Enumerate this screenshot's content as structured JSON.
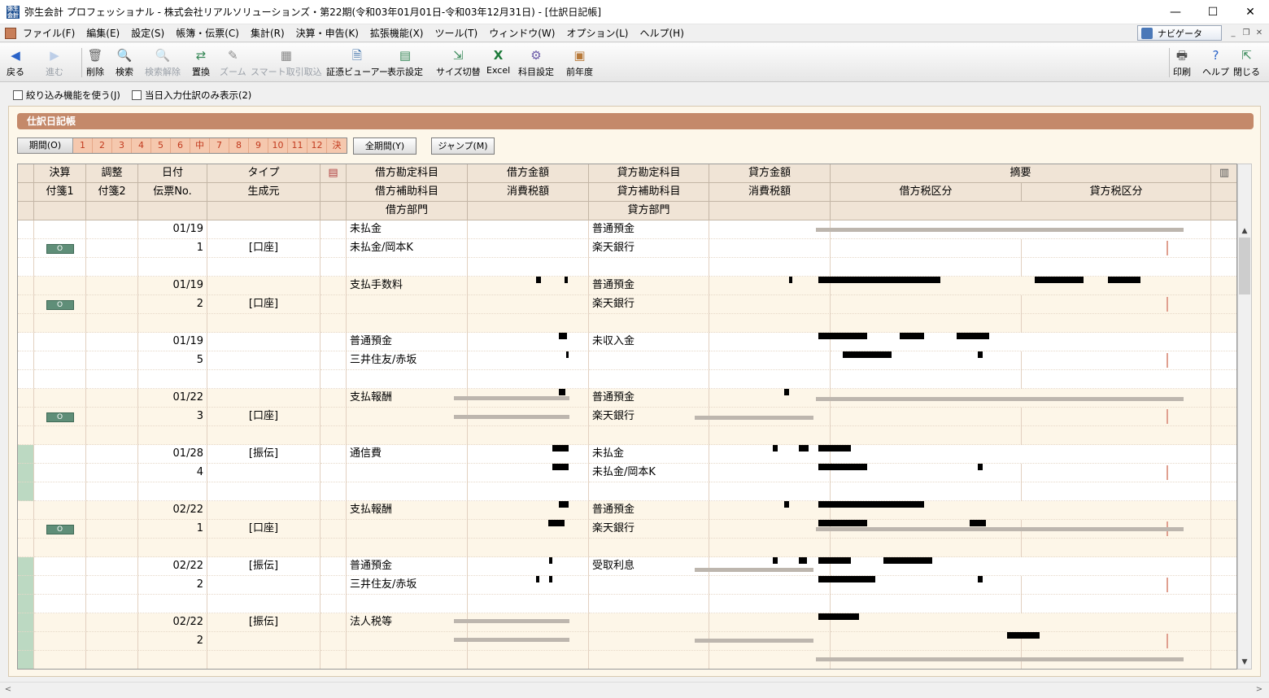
{
  "window": {
    "title": "弥生会計 プロフェッショナル - 株式会社リアルソリューションズ・第22期(令和03年01月01日-令和03年12月31日) - [仕訳日記帳]",
    "minimize": "—",
    "maximize": "☐",
    "close": "✕"
  },
  "menu": {
    "items": [
      "ファイル(F)",
      "編集(E)",
      "設定(S)",
      "帳簿・伝票(C)",
      "集計(R)",
      "決算・申告(K)",
      "拡張機能(X)",
      "ツール(T)",
      "ウィンドウ(W)",
      "オプション(L)",
      "ヘルプ(H)"
    ],
    "navigator": "ナビゲータ"
  },
  "toolbar": {
    "back": "戻る",
    "forward": "進む",
    "delete": "削除",
    "search": "検索",
    "search_clear": "検索解除",
    "replace": "置換",
    "zoom": "ズーム",
    "smart_import": "スマート取引取込",
    "voucher_viewer": "証憑ビューアー",
    "display_settings": "表示設定",
    "size_toggle": "サイズ切替",
    "excel": "Excel",
    "account_settings": "科目設定",
    "prev_year": "前年度",
    "print": "印刷",
    "help": "ヘルプ",
    "close": "閉じる"
  },
  "filters": {
    "narrow": "絞り込み機能を使う(J)",
    "today_only": "当日入力仕訳のみ表示(2)"
  },
  "journal": {
    "header_title": "仕訳日記帳",
    "period_label": "期間(O)",
    "periods": [
      "1",
      "2",
      "3",
      "4",
      "5",
      "6",
      "中",
      "7",
      "8",
      "9",
      "10",
      "11",
      "12",
      "決"
    ],
    "all_period_button": "全期間(Y)",
    "jump_button": "ジャンプ(M)"
  },
  "grid": {
    "header_row1": {
      "kessan": "決算",
      "chosei": "調整",
      "date": "日付",
      "type": "タイプ",
      "debit_account": "借方勘定科目",
      "debit_amount": "借方金額",
      "credit_account": "貸方勘定科目",
      "credit_amount": "貸方金額",
      "memo": "摘要"
    },
    "header_row2": {
      "fusen1": "付箋1",
      "fusen2": "付箋2",
      "voucher_no": "伝票No.",
      "source": "生成元",
      "debit_sub": "借方補助科目",
      "debit_tax": "消費税額",
      "credit_sub": "貸方補助科目",
      "credit_tax": "消費税額",
      "debit_tax_class": "借方税区分",
      "credit_tax_class": "貸方税区分"
    },
    "header_row3": {
      "debit_dept": "借方部門",
      "credit_dept": "貸方部門"
    },
    "fusen_label": "O",
    "entries": [
      {
        "date": "01/19",
        "no": "1",
        "source": "[口座]",
        "debit": "未払金",
        "debit_sub": "未払金/岡本K",
        "credit": "普通預金",
        "credit_sub": "楽天銀行",
        "fusen": true,
        "marker": ""
      },
      {
        "date": "01/19",
        "no": "2",
        "source": "[口座]",
        "debit": "支払手数料",
        "debit_sub": "",
        "credit": "普通預金",
        "credit_sub": "楽天銀行",
        "fusen": true,
        "marker": ""
      },
      {
        "date": "01/19",
        "no": "5",
        "source": "",
        "debit": "普通預金",
        "debit_sub": "三井住友/赤坂",
        "credit": "未収入金",
        "credit_sub": "",
        "fusen": false,
        "marker": ""
      },
      {
        "date": "01/22",
        "no": "3",
        "source": "[口座]",
        "debit": "支払報酬",
        "debit_sub": "",
        "credit": "普通預金",
        "credit_sub": "楽天銀行",
        "fusen": true,
        "marker": ""
      },
      {
        "date": "01/28",
        "no": "4",
        "type": "[振伝]",
        "source": "",
        "debit": "通信費",
        "debit_sub": "",
        "credit": "未払金",
        "credit_sub": "未払金/岡本K",
        "fusen": false,
        "marker": "#bcd9c2"
      },
      {
        "date": "02/22",
        "no": "1",
        "source": "[口座]",
        "debit": "支払報酬",
        "debit_sub": "",
        "credit": "普通預金",
        "credit_sub": "楽天銀行",
        "fusen": true,
        "marker": ""
      },
      {
        "date": "02/22",
        "no": "2",
        "type": "[振伝]",
        "source": "",
        "debit": "普通預金",
        "debit_sub": "三井住友/赤坂",
        "credit": "受取利息",
        "credit_sub": "",
        "fusen": false,
        "marker": "#bcd9c2"
      },
      {
        "date": "02/22",
        "no": "2",
        "type": "[振伝]",
        "source": "",
        "debit": "法人税等",
        "debit_sub": "",
        "credit": "",
        "credit_sub": "",
        "fusen": false,
        "marker": "#bcd9c2"
      }
    ]
  },
  "colors": {
    "accent_header": "#c4896a",
    "period_cell": "#f5c8ae",
    "fusen_green": "#5f8e78",
    "row_marker_green": "#bcd9c2"
  }
}
